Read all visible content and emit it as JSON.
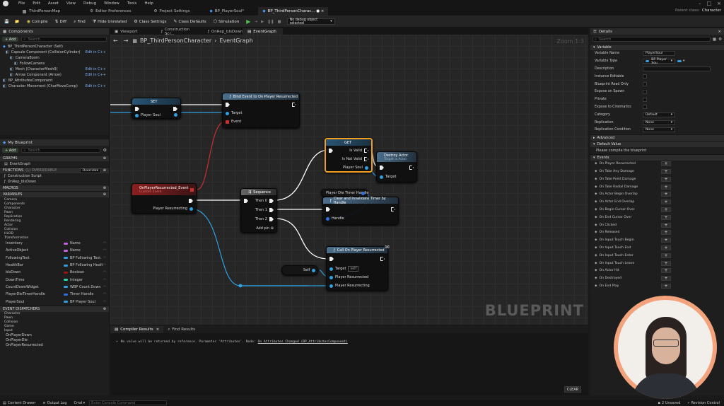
{
  "menu": [
    "File",
    "Edit",
    "Asset",
    "View",
    "Debug",
    "Window",
    "Tools",
    "Help"
  ],
  "tabs": [
    "ThirdPersonMap",
    "Editor Preferences",
    "Project Settings",
    "BP_PlayerSoul*",
    "BP_ThirdPersonCharac... ● ×"
  ],
  "parent_class_label": "Parent class:",
  "parent_class_value": "Character",
  "toolbar": {
    "compile": "Compile",
    "diff": "Diff",
    "find": "Find",
    "hide_unrelated": "Hide Unrelated",
    "class_settings": "Class Settings",
    "class_defaults": "Class Defaults",
    "simulation": "Simulation",
    "debug_dropdown": "No debug object selected"
  },
  "components": {
    "title": "Components",
    "add": "+ Add",
    "search": "Search",
    "self": "BP_ThirdPersonCharacter (Self)",
    "items": [
      {
        "name": "Capsule Component (CollisionCylinder)",
        "edit": "Edit in C++"
      },
      {
        "name": "CameraBoom",
        "edit": ""
      },
      {
        "name": "FollowCamera",
        "edit": ""
      },
      {
        "name": "Mesh (CharacterMesh0)",
        "edit": "Edit in C++"
      },
      {
        "name": "Arrow Component (Arrow)",
        "edit": "Edit in C++"
      },
      {
        "name": "BP_AttributesComponent",
        "edit": ""
      },
      {
        "name": "Character Movement (CharMoveComp)",
        "edit": "Edit in C++"
      }
    ]
  },
  "myblueprint": {
    "title": "My Blueprint",
    "add": "+ Add",
    "search": "Search",
    "graphs": "GRAPHS",
    "eventgraph": "EventGraph",
    "functions": "FUNCTIONS",
    "functions_count": "(1) OVERRIDABLE",
    "override": "Override",
    "fn_items": [
      "Construction Script",
      "OnRep_bIsDown"
    ],
    "macros": "MACROS",
    "variables": "VARIABLES",
    "var_cats": [
      "Camera",
      "Components",
      "Character",
      "Pawn",
      "Replication",
      "Rendering",
      "Actor",
      "Collision",
      "HLOD",
      "Transformation"
    ],
    "vars": [
      {
        "name": "Inventory",
        "type": "Name",
        "color": "#c862e6"
      },
      {
        "name": "ActiveObject",
        "type": "Name",
        "color": "#c862e6"
      },
      {
        "name": "FollowingText",
        "type": "BP Following Text",
        "color": "#2fa0e0"
      },
      {
        "name": "HealthBar",
        "type": "BP Following Healt",
        "color": "#2fa0e0"
      },
      {
        "name": "bIsDown",
        "type": "Boolean",
        "color": "#9a1414"
      },
      {
        "name": "DownTime",
        "type": "Integer",
        "color": "#2fd9b0"
      },
      {
        "name": "CountDownWidget",
        "type": "WBP Count Down",
        "color": "#2fa0e0"
      },
      {
        "name": "PlayerDieTimerHandle",
        "type": "Timer Handle",
        "color": "#2f6fe0"
      },
      {
        "name": "PlayerSoul",
        "type": "BP Player Soul",
        "color": "#2fa0e0"
      }
    ],
    "dispatchers": "EVENT DISPATCHERS",
    "disp_cats": [
      "Character",
      "Pawn",
      "Collision",
      "Game",
      "Input"
    ],
    "disp_items": [
      "OnPlayerDown",
      "OnPlayerDie",
      "OnPlayerResurrected"
    ]
  },
  "graph_tabs": [
    "Viewport",
    "Construction Scr...",
    "OnRep_bIsDown",
    "EventGraph"
  ],
  "breadcrumb": {
    "bp": "BP_ThirdPersonCharacter",
    "graph": "EventGraph"
  },
  "zoom": "Zoom 1:3",
  "watermark": "BLUEPRINT",
  "nodes": {
    "set": {
      "title": "SET",
      "pin": "Player Soul"
    },
    "bind": {
      "title": "Bind Event to On Player Resurrected",
      "target": "Target",
      "event": "Event"
    },
    "custom": {
      "title": "OnPlayerResurrected_Event",
      "subtitle": "Custom Event",
      "pin": "Player Resurrecting"
    },
    "seq": {
      "title": "Sequence",
      "then0": "Then 0",
      "then1": "Then 1",
      "then2": "Then 2",
      "add": "Add pin ⊕"
    },
    "isvalid": {
      "title": "GET",
      "valid": "Is Valid",
      "notvalid": "Is Not Valid",
      "pin": "Player Soul"
    },
    "destroy": {
      "title": "Destroy Actor",
      "subtitle": "Target is Actor",
      "target": "Target"
    },
    "handlevar": {
      "title": "Player Die Timer Handle"
    },
    "clear": {
      "title": "Clear and Invalidate Timer by Handle",
      "handle": "Handle"
    },
    "call": {
      "title": "Call On Player Resurrected",
      "target": "Target",
      "self": "self",
      "p1": "Player Resurrected",
      "p2": "Player Resurrecting"
    },
    "self": {
      "title": "Self"
    }
  },
  "output": {
    "tab1": "Compiler Results",
    "tab2": "Find Results",
    "msg": "No value will be returned by reference. Parameter 'Attributes'. Node:",
    "link": "On Attributes Changed (BP_AttributesComponent)",
    "clear": "CLEAR"
  },
  "details": {
    "title": "Details",
    "search": "Search",
    "variable": "Variable",
    "rows": [
      {
        "label": "Variable Name",
        "value": "PlayerSoul",
        "kind": "text"
      },
      {
        "label": "Variable Type",
        "value": "BP Player Sou",
        "kind": "type"
      },
      {
        "label": "Description",
        "value": "",
        "kind": "text"
      },
      {
        "label": "Instance Editable",
        "value": "",
        "kind": "check"
      },
      {
        "label": "Blueprint Read Only",
        "value": "",
        "kind": "check"
      },
      {
        "label": "Expose on Spawn",
        "value": "",
        "kind": "check"
      },
      {
        "label": "Private",
        "value": "",
        "kind": "check"
      },
      {
        "label": "Expose to Cinematics",
        "value": "",
        "kind": "check"
      },
      {
        "label": "Category",
        "value": "Default",
        "kind": "dd"
      },
      {
        "label": "Replication",
        "value": "None",
        "kind": "dd"
      },
      {
        "label": "Replication Condition",
        "value": "None",
        "kind": "dd"
      }
    ],
    "advanced": "Advanced",
    "default_value": "Default Value",
    "compile_msg": "Please compile the blueprint",
    "events": "Events",
    "event_items": [
      "On Player Resurrected",
      "On Take Any Damage",
      "On Take Point Damage",
      "On Take Radial Damage",
      "On Actor Begin Overlap",
      "On Actor End Overlap",
      "On Begin Cursor Over",
      "On End Cursor Over",
      "On Clicked",
      "On Released",
      "On Input Touch Begin",
      "On Input Touch End",
      "On Input Touch Enter",
      "On Input Touch Leave",
      "On Actor Hit",
      "On Destroyed",
      "On End Play"
    ]
  },
  "status": {
    "drawer": "Content Drawer",
    "output": "Output Log",
    "cmd": "Cmd",
    "console": "Enter Console Command",
    "unsaved": "2 Unsaved",
    "revision": "Revision Control"
  }
}
